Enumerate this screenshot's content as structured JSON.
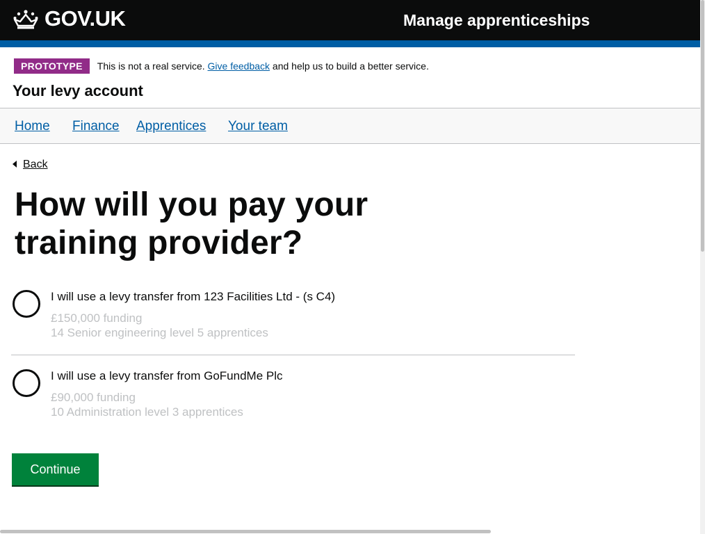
{
  "header": {
    "logo_text": "GOV.UK",
    "service_name": "Manage apprenticeships"
  },
  "phase_banner": {
    "tag": "PROTOTYPE",
    "text_before": "This is not a real service. ",
    "link": "Give feedback",
    "text_after": " and help us to build a better service."
  },
  "account_title": "Your levy account",
  "nav": {
    "items": [
      {
        "label": "Home"
      },
      {
        "label": "Finance"
      },
      {
        "label": "Apprentices"
      },
      {
        "label": "Your team"
      }
    ]
  },
  "back_link": "Back",
  "heading": "How will you pay your training provider?",
  "options": [
    {
      "label": "I will use a levy transfer from 123 Facilities Ltd - (s C4)",
      "funding": "£150,000 funding",
      "detail": "14 Senior engineering level 5 apprentices",
      "selected": false
    },
    {
      "label": "I will use a levy transfer from GoFundMe Plc",
      "funding": "£90,000 funding",
      "detail": "10 Administration level 3 apprentices",
      "selected": false
    }
  ],
  "continue_label": "Continue",
  "colors": {
    "header_bg": "#0b0c0c",
    "brand_blue": "#005ea5",
    "phase_tag": "#912b88",
    "button_green": "#00823b",
    "hint_grey": "#bfc1c3"
  },
  "icons": {
    "logo": "crown-icon",
    "back": "triangle-left-icon"
  }
}
